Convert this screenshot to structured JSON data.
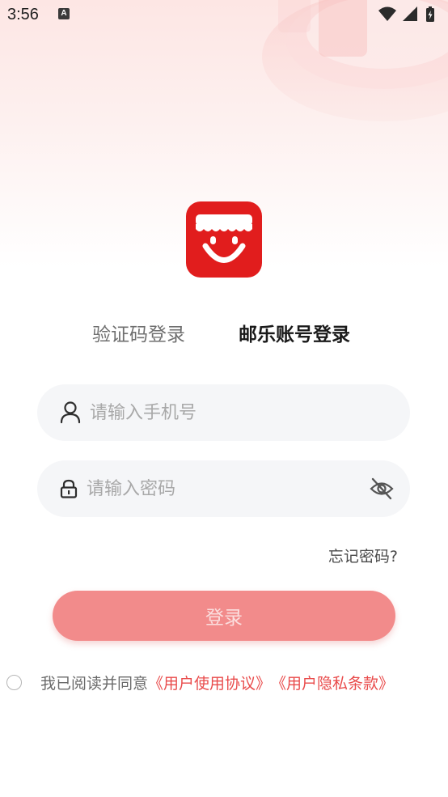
{
  "status_bar": {
    "time": "3:56",
    "notification_icon": "A",
    "icons": [
      "wifi-icon",
      "signal-icon",
      "battery-charging-icon"
    ]
  },
  "app": {
    "logo_icon": "shop-smile-icon",
    "brand_color": "#e11d1d"
  },
  "tabs": [
    {
      "label": "验证码登录",
      "active": false
    },
    {
      "label": "邮乐账号登录",
      "active": true
    }
  ],
  "form": {
    "phone": {
      "placeholder": "请输入手机号",
      "value": "",
      "icon": "user-icon"
    },
    "password": {
      "placeholder": "请输入密码",
      "value": "",
      "icon": "lock-icon",
      "toggle_icon": "eye-off-icon"
    },
    "forgot_label": "忘记密码?",
    "login_label": "登录"
  },
  "agreement": {
    "checked": false,
    "text": "我已阅读并同意",
    "links": [
      "《用户使用协议》",
      "《用户隐私条款》"
    ]
  },
  "colors": {
    "accent": "#e94b4b",
    "button": "#f28b8b",
    "field_bg": "#f5f6f8"
  }
}
